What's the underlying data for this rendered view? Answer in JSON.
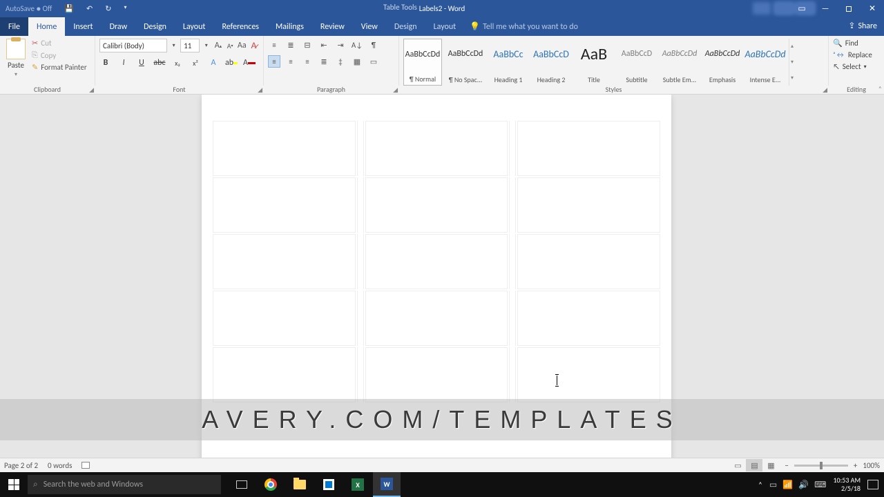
{
  "titlebar": {
    "autosave": "AutoSave ● Off",
    "doc_title": "Labels2 - Word",
    "table_tools": "Table Tools"
  },
  "tabs": {
    "file": "File",
    "home": "Home",
    "insert": "Insert",
    "draw": "Draw",
    "design": "Design",
    "layout": "Layout",
    "references": "References",
    "mailings": "Mailings",
    "review": "Review",
    "view": "View",
    "ctx_design": "Design",
    "ctx_layout": "Layout",
    "tellme": "Tell me what you want to do",
    "share": "Share"
  },
  "ribbon": {
    "clipboard": {
      "paste": "Paste",
      "cut": "Cut",
      "copy": "Copy",
      "format_painter": "Format Painter",
      "label": "Clipboard"
    },
    "font": {
      "name": "Calibri (Body)",
      "size": "11",
      "label": "Font"
    },
    "paragraph": {
      "label": "Paragraph"
    },
    "styles": {
      "label": "Styles",
      "items": [
        {
          "preview": "AaBbCcDd",
          "name": "¶ Normal",
          "cls": ""
        },
        {
          "preview": "AaBbCcDd",
          "name": "¶ No Spac...",
          "cls": ""
        },
        {
          "preview": "AaBbCc",
          "name": "Heading 1",
          "cls": "blue"
        },
        {
          "preview": "AaBbCcD",
          "name": "Heading 2",
          "cls": "blue"
        },
        {
          "preview": "AaB",
          "name": "Title",
          "cls": "big"
        },
        {
          "preview": "AaBbCcD",
          "name": "Subtitle",
          "cls": "light"
        },
        {
          "preview": "AaBbCcDd",
          "name": "Subtle Em...",
          "cls": "light italic"
        },
        {
          "preview": "AaBbCcDd",
          "name": "Emphasis",
          "cls": "italic"
        },
        {
          "preview": "AaBbCcDd",
          "name": "Intense E...",
          "cls": "blue italic"
        }
      ]
    },
    "editing": {
      "find": "Find",
      "replace": "Replace",
      "select": "Select",
      "label": "Editing"
    }
  },
  "banner": "AVERY.COM/TEMPLATES",
  "status": {
    "page": "Page 2 of 2",
    "words": "0 words",
    "zoom": "100%"
  },
  "taskbar": {
    "search_placeholder": "Search the web and Windows",
    "time": "10:53 AM",
    "date": "2/5/18"
  }
}
